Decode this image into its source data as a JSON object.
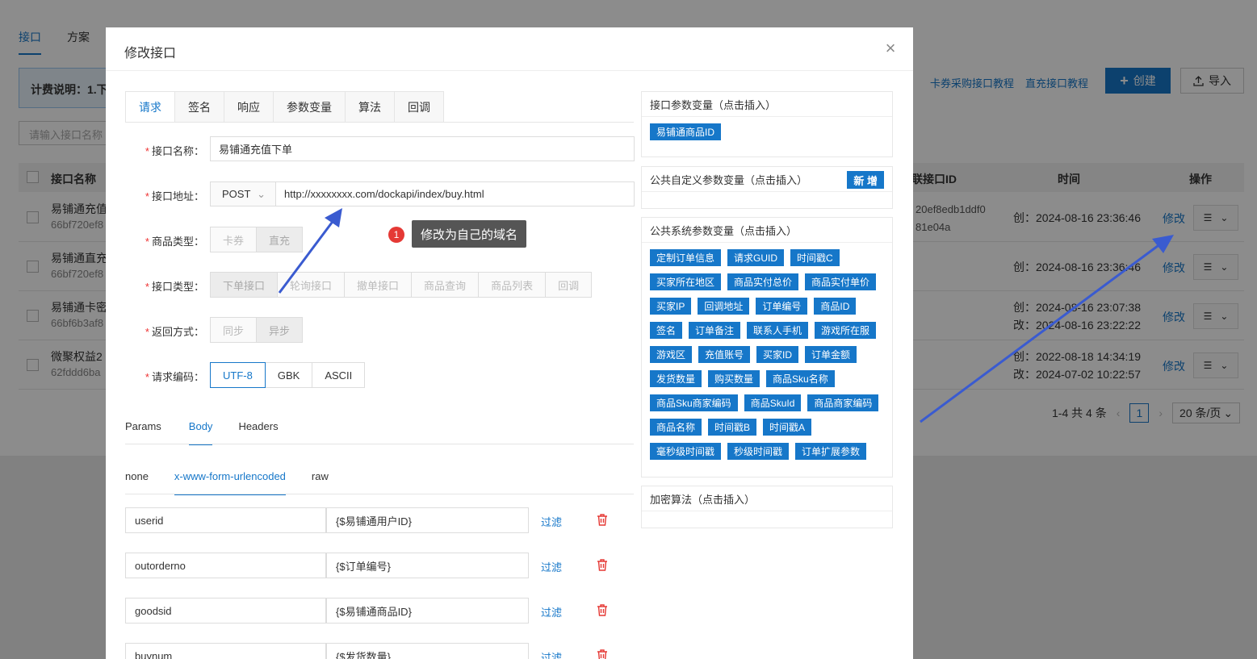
{
  "background": {
    "tabs": [
      {
        "label": "接口",
        "active": true
      },
      {
        "label": "方案",
        "active": false
      }
    ],
    "billing_label": "计费说明：1.下",
    "search_placeholder": "请输入接口名称",
    "links": [
      "卡券采购接口教程",
      "直充接口教程"
    ],
    "create_label": "创建",
    "import_label": "导入",
    "table": {
      "headers": {
        "name": "接口名称",
        "link_id": "关联接口ID",
        "time": "时间",
        "actions": "操作"
      },
      "rows": [
        {
          "name": "易铺通充值",
          "id": "66bf720ef8",
          "link_id_1": "20ef8edb1ddf0",
          "link_id_2": "81e04a",
          "time_1": "创：2024-08-16 23:36:46",
          "time_2": "",
          "edit": "修改"
        },
        {
          "name": "易铺通直充",
          "id": "66bf720ef8",
          "link_id_1": "",
          "link_id_2": "",
          "time_1": "创：2024-08-16 23:36:46",
          "time_2": "",
          "edit": "修改"
        },
        {
          "name": "易铺通卡密",
          "id": "66bf6b3af8",
          "link_id_1": "",
          "link_id_2": "",
          "time_1": "创：2024-08-16 23:07:38",
          "time_2": "改：2024-08-16 23:22:22",
          "edit": "修改"
        },
        {
          "name": "微聚权益2",
          "id": "62fddd6ba",
          "link_id_1": "",
          "link_id_2": "",
          "time_1": "创：2022-08-18 14:34:19",
          "time_2": "改：2024-07-02 10:22:57",
          "edit": "修改"
        }
      ]
    },
    "pager": {
      "summary": "1-4 共 4 条",
      "page": "1",
      "size": "20 条/页"
    }
  },
  "modal": {
    "title": "修改接口",
    "tabs": [
      {
        "label": "请求",
        "active": true
      },
      {
        "label": "签名",
        "active": false
      },
      {
        "label": "响应",
        "active": false
      },
      {
        "label": "参数变量",
        "active": false
      },
      {
        "label": "算法",
        "active": false
      },
      {
        "label": "回调",
        "active": false
      }
    ],
    "form": {
      "name_label": "接口名称：",
      "name_value": "易铺通充值下单",
      "url_label": "接口地址：",
      "method": "POST",
      "url_value": "http://xxxxxxxx.com/dockapi/index/buy.html",
      "goods_type_label": "商品类型：",
      "goods_types": [
        "卡券",
        "直充"
      ],
      "api_type_label": "接口类型：",
      "api_types": [
        "下单接口",
        "轮询接口",
        "撤单接口",
        "商品查询",
        "商品列表",
        "回调"
      ],
      "return_label": "返回方式：",
      "return_types": [
        "同步",
        "异步"
      ],
      "encoding_label": "请求编码：",
      "encodings": [
        "UTF-8",
        "GBK",
        "ASCII"
      ]
    },
    "param_tabs": [
      {
        "label": "Params",
        "active": false
      },
      {
        "label": "Body",
        "active": true
      },
      {
        "label": "Headers",
        "active": false
      }
    ],
    "body_tabs": [
      {
        "label": "none",
        "active": false
      },
      {
        "label": "x-www-form-urlencoded",
        "active": true
      },
      {
        "label": "raw",
        "active": false
      }
    ],
    "params": [
      {
        "key": "userid",
        "value": "{$易铺通用户ID}"
      },
      {
        "key": "outorderno",
        "value": "{$订单编号}"
      },
      {
        "key": "goodsid",
        "value": "{$易铺通商品ID}"
      },
      {
        "key": "buynum",
        "value": "{$发货数量}"
      }
    ],
    "filter_label": "过滤",
    "annotation": {
      "number": "1",
      "text": "修改为自己的域名"
    },
    "panels": {
      "api_params": {
        "title": "接口参数变量（点击插入）",
        "chips": [
          "易铺通商品ID"
        ]
      },
      "custom_params": {
        "title": "公共自定义参数变量（点击插入）",
        "add_label": "新 增"
      },
      "system_params": {
        "title": "公共系统参数变量（点击插入）",
        "chips": [
          "定制订单信息",
          "请求GUID",
          "时间戳C",
          "买家所在地区",
          "商品实付总价",
          "商品实付单价",
          "买家IP",
          "回调地址",
          "订单编号",
          "商品ID",
          "签名",
          "订单备注",
          "联系人手机",
          "游戏所在服",
          "游戏区",
          "充值账号",
          "买家ID",
          "订单金额",
          "发货数量",
          "购买数量",
          "商品Sku名称",
          "商品Sku商家编码",
          "商品SkuId",
          "商品商家编码",
          "商品名称",
          "时间戳B",
          "时间戳A",
          "毫秒级时间戳",
          "秒级时间戳",
          "订单扩展参数"
        ]
      },
      "encrypt": {
        "title": "加密算法（点击插入）"
      }
    }
  },
  "colors": {
    "accent": "#1677c9",
    "danger": "#e53935",
    "arrow": "#3a5bd0"
  }
}
